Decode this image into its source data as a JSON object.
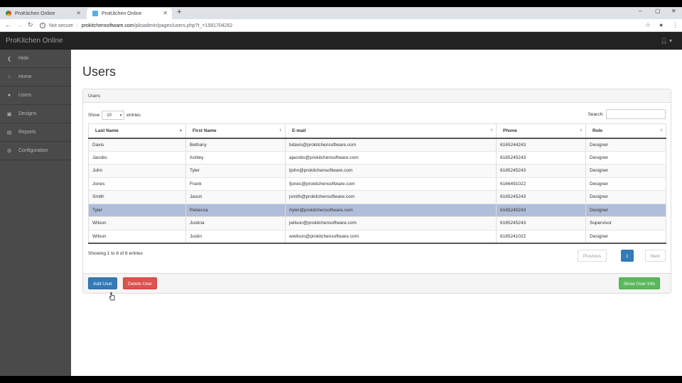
{
  "browser": {
    "tabs": [
      {
        "title": "ProKitchen Online",
        "active": false
      },
      {
        "title": "ProKitchen Online",
        "active": true
      }
    ],
    "new_tab_symbol": "+",
    "security_label": "Not secure",
    "url_host": "prokitchensoftware.com",
    "url_path": "/pkoadmin/pages/users.php?t_=1581704262",
    "window_controls": [
      "–",
      "▢",
      "✕"
    ]
  },
  "app": {
    "brand": "ProKitchen Online",
    "user_menu_icon": "user-icon"
  },
  "sidebar": {
    "items": [
      {
        "label": "Hide",
        "icon": "chevron-left-icon"
      },
      {
        "label": "Home",
        "icon": "home-icon"
      },
      {
        "label": "Users",
        "icon": "user-icon"
      },
      {
        "label": "Designs",
        "icon": "image-icon"
      },
      {
        "label": "Reports",
        "icon": "report-icon"
      },
      {
        "label": "Configuration",
        "icon": "gear-icon"
      }
    ]
  },
  "page": {
    "title": "Users",
    "panel_heading": "Users",
    "length_prefix": "Show",
    "length_value": "10",
    "length_suffix": "entries",
    "search_label": "Search:",
    "search_value": "",
    "columns": [
      "Last Name",
      "First Name",
      "E-mail",
      "Phone",
      "Role"
    ],
    "rows": [
      {
        "last": "Davis",
        "first": "Bethany",
        "email": "bdavis@prokitchensoftware.com",
        "phone": "6165244243",
        "role": "Designer"
      },
      {
        "last": "Jacobs",
        "first": "Ashley",
        "email": "ajacobs@prokitchensoftware.com",
        "phone": "6165245243",
        "role": "Designer"
      },
      {
        "last": "John",
        "first": "Tyler",
        "email": "tjohn@prokitchensoftware.com",
        "phone": "6165245243",
        "role": "Designer"
      },
      {
        "last": "Jones",
        "first": "Frank",
        "email": "fjones@prokitchensoftware.com",
        "phone": "6166491022",
        "role": "Designer"
      },
      {
        "last": "Smith",
        "first": "Jason",
        "email": "jsmith@prokitchensoftware.com",
        "phone": "6165245243",
        "role": "Designer"
      },
      {
        "last": "Tyler",
        "first": "Rebecca",
        "email": "rtyler@prokitchensoftware.com",
        "phone": "6165245243",
        "role": "Designer"
      },
      {
        "last": "Wilson",
        "first": "Justina",
        "email": "jwilson@prokitchensoftware.com",
        "phone": "6165245243",
        "role": "Supervisor"
      },
      {
        "last": "Wilson",
        "first": "Justin",
        "email": "wwilson@prokitchensoftware.com",
        "phone": "6165241022",
        "role": "Designer"
      }
    ],
    "selected_row_index": 5,
    "info": "Showing 1 to 8 of 8 entries",
    "pager": {
      "previous": "Previous",
      "current": "1",
      "next": "Next"
    },
    "buttons": {
      "add": "Add User",
      "delete": "Delete User",
      "show_info": "Show User Info"
    }
  },
  "colors": {
    "primary": "#337ab7",
    "danger": "#d9534f",
    "success": "#5cb85c",
    "selected_row": "#b0bed9",
    "navbar": "#222222",
    "sidebar": "#4a4a4a"
  }
}
